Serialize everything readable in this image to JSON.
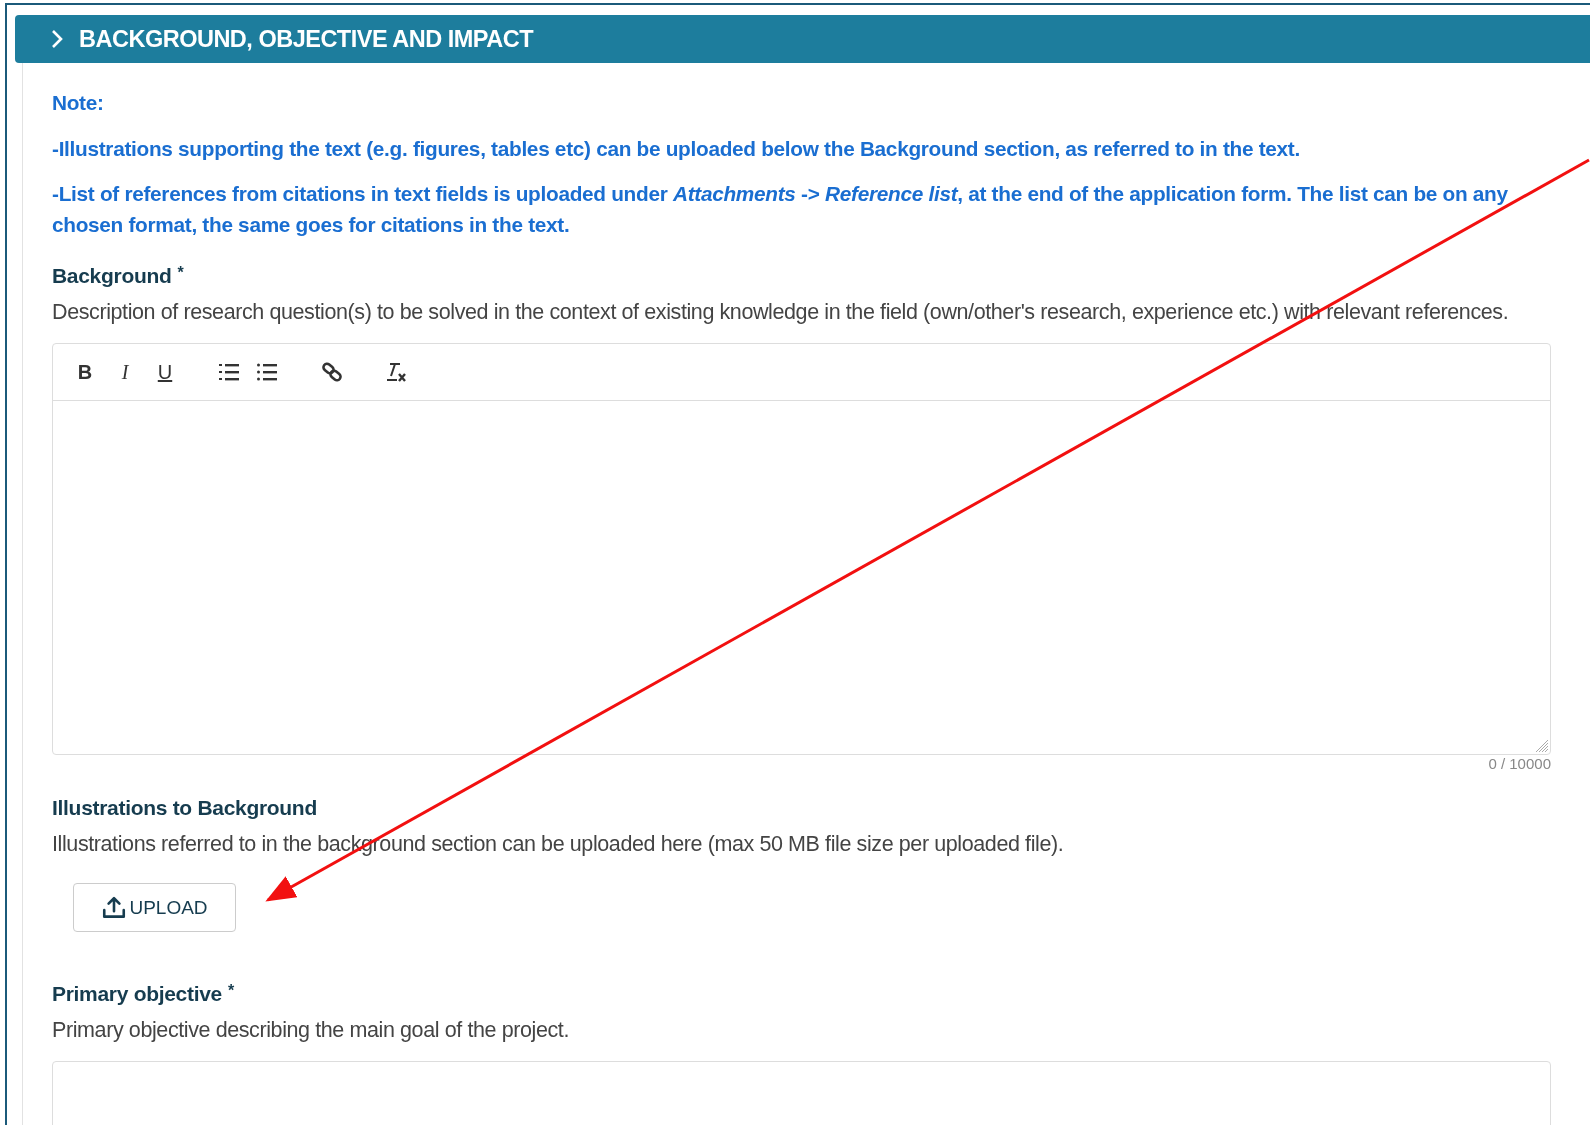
{
  "section": {
    "title": "BACKGROUND, OBJECTIVE AND IMPACT"
  },
  "note": {
    "label": "Note:",
    "lines": [
      "-Illustrations supporting the text (e.g. figures, tables etc) can be uploaded below the Background section, as referred to in the text.",
      "-List of references from citations in text fields is uploaded under *Attachments* -> *Reference list*, at the end of the application form. The list can be on any chosen format, the same goes for citations in the text."
    ]
  },
  "fields": [
    {
      "kind": "richtext",
      "label": "Background",
      "required_mark": "*",
      "description": "Description of research question(s) to be solved in the context of existing knowledge in the field (own/other's research, experience etc.) with relevant references.",
      "format_buttons": [
        "B",
        "I",
        "U"
      ],
      "counter": "0 / 10000"
    },
    {
      "kind": "upload",
      "label": "Illustrations to Background",
      "description": "Illustrations referred to in the background section can be uploaded here (max 50 MB file size per uploaded file).",
      "button": "UPLOAD"
    },
    {
      "kind": "textarea",
      "label": "Primary objective",
      "required_mark": "*",
      "description": "Primary objective describing the main goal of the project."
    }
  ]
}
